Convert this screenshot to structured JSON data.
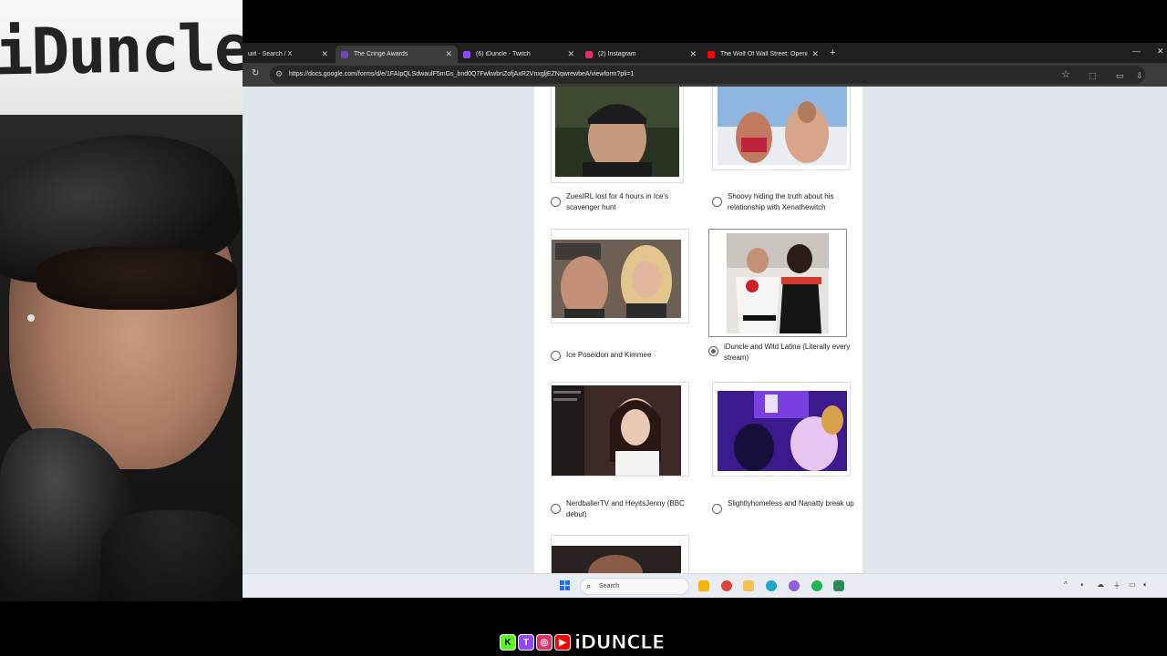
{
  "webcam": {
    "sign_text": "iDuncle"
  },
  "browser": {
    "tabs": [
      {
        "title": "uirl - Search / X",
        "favicon": "x-icon",
        "color": "#ffffff",
        "active": false
      },
      {
        "title": "The Cringe Awards",
        "favicon": "google-forms-icon",
        "color": "#7248b9",
        "active": true
      },
      {
        "title": "(6) iDuncle - Twitch",
        "favicon": "twitch-icon",
        "color": "#9146ff",
        "active": false
      },
      {
        "title": "(2) Instagram",
        "favicon": "instagram-icon",
        "color": "#e1306c",
        "active": false
      },
      {
        "title": "The Wolf Of Wall Street: Openi",
        "favicon": "youtube-icon",
        "color": "#ff0000",
        "active": false
      }
    ],
    "url": "https://docs.google.com/forms/d/e/1FAIpQLSdwaulF5mGs_bnd0Q7FwkwbnZofjAxR2VnxgljEZNqwrewbeA/viewform?pli=1"
  },
  "form": {
    "options": [
      {
        "label": "ZuesIRL lost for 4 hours in Ice's scavenger hunt",
        "checked": false,
        "image": "man-in-cap-outdoors"
      },
      {
        "label": "Shoovy hiding the truth about his relationship with Xenathewitch",
        "checked": false,
        "image": "couple-on-boat"
      },
      {
        "label": "Ice Poseidon and Kimmee",
        "checked": false,
        "image": "man-and-blonde-woman"
      },
      {
        "label": "iDuncle and Wild Latina (Literally every stream)",
        "checked": true,
        "image": "costumed-pair"
      },
      {
        "label": "NerdballerTV and HeyitsJenny (BBC debut)",
        "checked": false,
        "image": "stream-capture"
      },
      {
        "label": "Slightlyhomeless and Nanatty break up",
        "checked": false,
        "image": "purple-room"
      }
    ]
  },
  "taskbar": {
    "search_label": "Search",
    "apps": [
      "file-explorer-icon",
      "chrome-icon",
      "folder-icon",
      "edge-icon",
      "discord-icon",
      "spotify-icon",
      "app-icon"
    ]
  },
  "branding": {
    "socials": [
      {
        "name": "kick-icon",
        "glyph": "K",
        "color": "#53fc18"
      },
      {
        "name": "twitch-icon",
        "glyph": "T",
        "color": "#9146ff"
      },
      {
        "name": "instagram-icon",
        "glyph": "◎",
        "color": "#e1306c"
      },
      {
        "name": "youtube-icon",
        "glyph": "▶",
        "color": "#ff0000"
      }
    ],
    "name": "iDUNCLE"
  }
}
